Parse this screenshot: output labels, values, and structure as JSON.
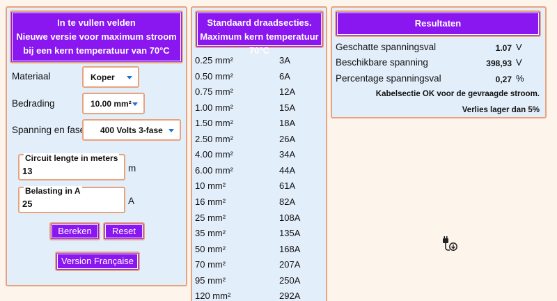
{
  "input_panel": {
    "header_lines": [
      "In te vullen velden",
      "Nieuwe versie voor maximum stroom",
      "bij een kern temperatuur van 70°C"
    ],
    "material_label": "Materiaal",
    "material_value": "Koper",
    "wiring_label": "Bedrading",
    "wiring_value": "10.00 mm²",
    "voltage_label": "Spanning en fase",
    "voltage_value": "400 Volts 3-fase",
    "length_legend": "Circuit lengte in meters",
    "length_value": "13",
    "length_unit": "m",
    "load_legend": "Belasting in A",
    "load_value": "25",
    "load_unit": "A",
    "calc_button": "Bereken",
    "reset_button": "Reset",
    "french_button": "Version Française"
  },
  "sections_panel": {
    "header_lines": [
      "Standaard draadsecties.",
      "Maximum kern temperatuur 70°C"
    ],
    "rows": [
      {
        "size": "0.25 mm²",
        "amps": "3A"
      },
      {
        "size": "0.50 mm²",
        "amps": "6A"
      },
      {
        "size": "0.75 mm²",
        "amps": "12A"
      },
      {
        "size": "1.00 mm²",
        "amps": "15A"
      },
      {
        "size": "1.50 mm²",
        "amps": "18A"
      },
      {
        "size": "2.50 mm²",
        "amps": "26A"
      },
      {
        "size": "4.00 mm²",
        "amps": "34A"
      },
      {
        "size": "6.00 mm²",
        "amps": "44A"
      },
      {
        "size": "10 mm²",
        "amps": "61A"
      },
      {
        "size": "16 mm²",
        "amps": "82A"
      },
      {
        "size": "25 mm²",
        "amps": "108A"
      },
      {
        "size": "35 mm²",
        "amps": "135A"
      },
      {
        "size": "50 mm²",
        "amps": "168A"
      },
      {
        "size": "70 mm²",
        "amps": "207A"
      },
      {
        "size": "95 mm²",
        "amps": "250A"
      },
      {
        "size": "120 mm²",
        "amps": "292A"
      }
    ]
  },
  "results_panel": {
    "header": "Resultaten",
    "drop_label": "Geschatte spanningsval",
    "drop_value": "1.07",
    "drop_unit": "V",
    "available_label": "Beschikbare spanning",
    "available_value": "398,93",
    "available_unit": "V",
    "percent_label": "Percentage spanningsval",
    "percent_value": "0,27",
    "percent_unit": "%",
    "message_ok": "Kabelsectie OK voor de gevraagde stroom.",
    "message_loss": "Verlies lager dan 5%"
  },
  "colors": {
    "accent": "#8a16f0",
    "border": "#e9a37c",
    "panel": "#e3eefb",
    "background": "#fdf4ec",
    "chevron": "#1f6fd6"
  },
  "icons": {
    "plug": "plug-icon"
  }
}
